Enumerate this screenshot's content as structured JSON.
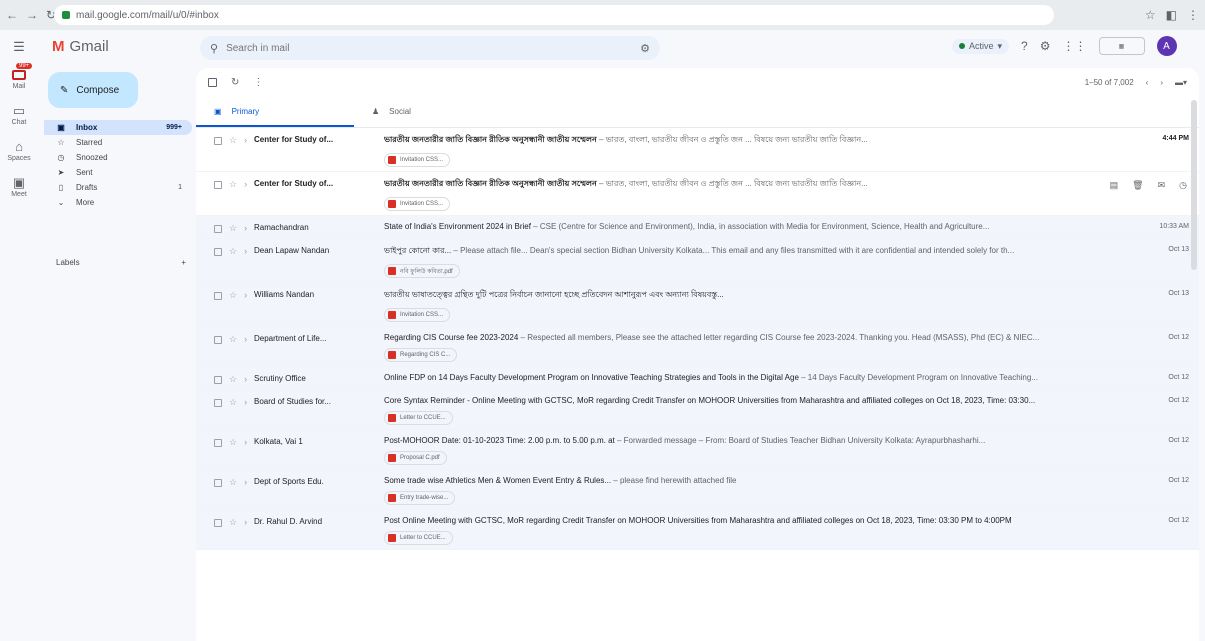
{
  "browser": {
    "url": "mail.google.com/mail/u/0/#inbox"
  },
  "app": {
    "name": "Gmail"
  },
  "search": {
    "placeholder": "Search in mail"
  },
  "header": {
    "status": "Active",
    "avatar_letter": "A"
  },
  "rail": [
    {
      "label": "Mail",
      "badge": "99+"
    },
    {
      "label": "Chat"
    },
    {
      "label": "Spaces"
    },
    {
      "label": "Meet"
    }
  ],
  "compose": {
    "label": "Compose"
  },
  "sidebar": {
    "items": [
      {
        "label": "Inbox",
        "count": "999+"
      },
      {
        "label": "Starred"
      },
      {
        "label": "Snoozed"
      },
      {
        "label": "Sent"
      },
      {
        "label": "Drafts",
        "count": "1"
      },
      {
        "label": "More"
      }
    ],
    "labels_heading": "Labels"
  },
  "toolbar": {
    "page_info": "1–50 of 7,002"
  },
  "tabs": [
    {
      "label": "Primary"
    },
    {
      "label": "Social"
    }
  ],
  "emails": [
    {
      "sender": "Center for Study of...",
      "subject": "ভারতীয় জনতারীর জাতি বিজ্ঞান রীতিক অনুসন্ধানী জাতীয় সম্মেলন",
      "snippet": " – ভারত, বাংলা, ভারতীয় জীবন ও প্রস্তুতি জন ... বিষয়ে জন্য ভারতীয় জাতি বিজ্ঞান...",
      "attachment": "Invitation CSS...",
      "date": "4:44 PM",
      "unread": true
    },
    {
      "sender": "Center for Study of...",
      "subject": "ভারতীয় জনতারীর জাতি বিজ্ঞান রীতিক অনুসন্ধানী জাতীয় সম্মেলন",
      "snippet": " – ভারত, বাংলা, ভারতীয় জীবন ও প্রস্তুতি জন ... বিষয়ে জন্য ভারতীয় জাতি বিজ্ঞান...",
      "attachment": "Invitation CSS...",
      "date": "",
      "unread": true,
      "hover": true
    },
    {
      "sender": "Ramachandran",
      "subject": "State of India's Environment 2024 in Brief",
      "snippet": " – CSE (Centre for Science and Environment), India, in association with Media for Environment, Science, Health and Agriculture...",
      "attachment": "",
      "date": "10:33 AM",
      "unread": false
    },
    {
      "sender": "Dean Lapaw Nandan",
      "subject": "ভাইপুর কোনো কার...",
      "snippet": " – Please attach file... Dean's special section Bidhan University Kolkata... This email and any files transmitted with it are confidential and intended solely for th...",
      "attachment": "নবি ফুলিউ কবিতা.pdf",
      "date": "Oct 13",
      "unread": false
    },
    {
      "sender": "Williams Nandan",
      "subject": "ভারতীয় ভাষাতত্ত্বের গ্রন্থিত দুটি পত্রের নির্বাচন জানানো হচ্ছে প্রতিবেদন আশানুরূপ এবং অন্যান্য বিষয়বস্তু...",
      "snippet": "",
      "attachment": "Invitation CSS...",
      "date": "Oct 13",
      "unread": false
    },
    {
      "sender": "Department of Life...",
      "subject": "Regarding CIS Course fee 2023-2024",
      "snippet": " – Respected all members, Please see the attached letter regarding CIS Course fee 2023-2024. Thanking you. Head (MSASS), Phd (EC) & NIEC...",
      "attachment": "Regarding CIS C...",
      "date": "Oct 12",
      "unread": false
    },
    {
      "sender": "Scrutiny Office",
      "subject": "Online FDP on 14 Days Faculty Development Program on Innovative Teaching Strategies and Tools in the Digital Age",
      "snippet": " – 14 Days Faculty Development Program on Innovative Teaching...",
      "attachment": "",
      "date": "Oct 12",
      "unread": false
    },
    {
      "sender": "Board of Studies for...",
      "subject": "Core Syntax Reminder - Online Meeting with GCTSC, MoR regarding Credit Transfer on MOHOOR Universities from Maharashtra and affiliated colleges on Oct 18, 2023, Time: 03:30...",
      "snippet": "",
      "attachment": "Letter to CCUE...",
      "date": "Oct 12",
      "unread": false
    },
    {
      "sender": "Kolkata, Vai 1",
      "subject": "Post-MOHOOR Date: 01-10-2023 Time: 2.00 p.m. to 5.00 p.m. at",
      "snippet": " – Forwarded message – From: Board of Studies Teacher Bidhan University Kolkata: Ayrapurbhasharhi...",
      "attachment": "Proposal C.pdf",
      "date": "Oct 12",
      "unread": false
    },
    {
      "sender": "Dept of Sports Edu.",
      "subject": "Some trade wise Athletics Men & Women Event Entry & Rules...",
      "snippet": " – please find herewith attached file",
      "attachment": "Entry trade-wise...",
      "date": "Oct 12",
      "unread": false
    },
    {
      "sender": "Dr. Rahul D. Arvind",
      "subject": "Post Online Meeting with GCTSC, MoR regarding Credit Transfer on MOHOOR Universities from Maharashtra and affiliated colleges on Oct 18, 2023, Time: 03:30 PM to 4:00PM",
      "snippet": "",
      "attachment": "Letter to CCUE...",
      "date": "Oct 12",
      "unread": false
    }
  ]
}
